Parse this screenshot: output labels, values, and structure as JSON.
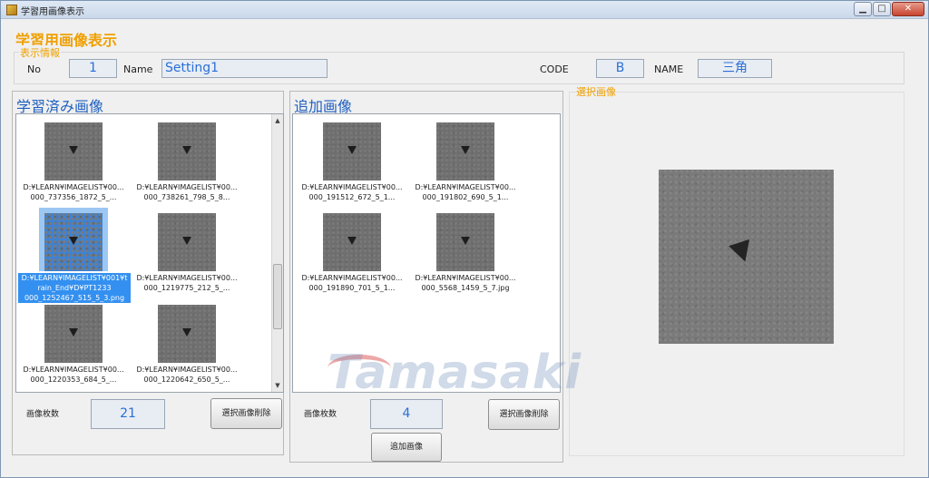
{
  "window": {
    "title": "学習用画像表示",
    "min": "▁",
    "max": "□",
    "close": "✕"
  },
  "header": {
    "title": "学習用画像表示"
  },
  "info": {
    "legend": "表示情報",
    "no_label": "No",
    "no_value": "1",
    "name_label": "Name",
    "name_value": "Setting1",
    "code_label": "CODE",
    "code_value": "B",
    "name2_label": "NAME",
    "name2_value": "三角"
  },
  "learned": {
    "title": "学習済み画像",
    "items": [
      {
        "line1": "D:¥LEARN¥IMAGELIST¥00...",
        "line2": "000_737356_1872_5_..."
      },
      {
        "line1": "D:¥LEARN¥IMAGELIST¥00...",
        "line2": "000_738261_798_5_8..."
      },
      {
        "line1": "D:¥LEARN¥IMAGELIST¥001¥t",
        "line2": "rain_End¥D¥PT1233",
        "line3": "000_1252467_515_5_3.png"
      },
      {
        "line1": "D:¥LEARN¥IMAGELIST¥00...",
        "line2": "000_1219775_212_5_..."
      },
      {
        "line1": "D:¥LEARN¥IMAGELIST¥00...",
        "line2": "000_1220353_684_5_..."
      },
      {
        "line1": "D:¥LEARN¥IMAGELIST¥00...",
        "line2": "000_1220642_650_5_..."
      }
    ],
    "count_label": "画像枚数",
    "count_value": "21",
    "delete_button": "選択画像削除"
  },
  "added": {
    "title": "追加画像",
    "items": [
      {
        "line1": "D:¥LEARN¥IMAGELIST¥00...",
        "line2": "000_191512_672_5_1..."
      },
      {
        "line1": "D:¥LEARN¥IMAGELIST¥00...",
        "line2": "000_191802_690_5_1..."
      },
      {
        "line1": "D:¥LEARN¥IMAGELIST¥00...",
        "line2": "000_191890_701_5_1..."
      },
      {
        "line1": "D:¥LEARN¥IMAGELIST¥00...",
        "line2": "000_5568_1459_5_7.jpg"
      }
    ],
    "count_label": "画像枚数",
    "count_value": "4",
    "delete_button": "選択画像削除",
    "add_button": "追加画像"
  },
  "selected": {
    "legend": "選択画像"
  },
  "watermark": "Tamasaki"
}
